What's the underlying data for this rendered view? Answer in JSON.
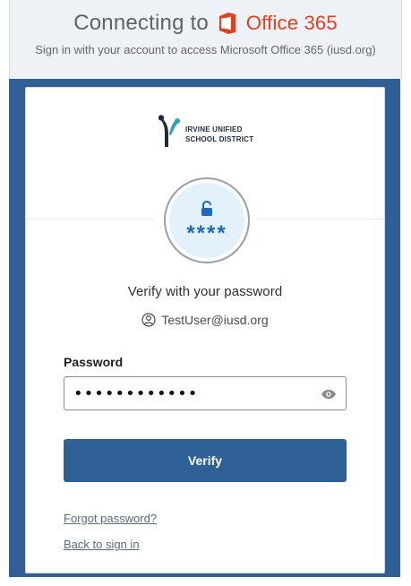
{
  "banner": {
    "connecting_label": "Connecting to",
    "product_label": "Office 365",
    "subtitle": "Sign in with your account to access Microsoft Office 365 (iusd.org)"
  },
  "district_logo": {
    "line1": "IRVINE UNIFIED",
    "line2": "SCHOOL DISTRICT"
  },
  "badge": {
    "stars": "****"
  },
  "form": {
    "title": "Verify with your password",
    "username": "TestUser@iusd.org",
    "password_label": "Password",
    "password_value": "••••••••••••",
    "verify_button_label": "Verify",
    "forgot_password_label": "Forgot password?",
    "back_to_sign_in_label": "Back to sign in"
  },
  "colors": {
    "office_red": "#e43e1b",
    "brand_blue": "#2f5f95",
    "badge_fill": "#e3f1fb",
    "badge_icon_blue": "#1e6bb8"
  },
  "icons": {
    "office": "office-logo-icon",
    "unlock": "unlock-icon",
    "user": "user-circle-icon",
    "eye": "eye-icon"
  }
}
